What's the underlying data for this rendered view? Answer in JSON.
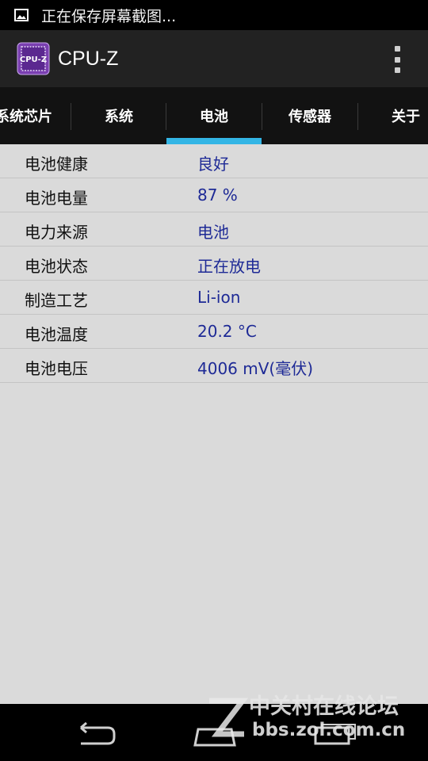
{
  "status_bar": {
    "notification_text": "正在保存屏幕截图...",
    "icon": "image-icon"
  },
  "action_bar": {
    "app_icon_text": "CPU-Z",
    "title": "CPU-Z"
  },
  "tabs": [
    {
      "label": "系统芯片",
      "active": false
    },
    {
      "label": "系统",
      "active": false
    },
    {
      "label": "电池",
      "active": true
    },
    {
      "label": "传感器",
      "active": false
    },
    {
      "label": "关于",
      "active": false
    }
  ],
  "battery_rows": [
    {
      "key": "电池健康",
      "value": "良好"
    },
    {
      "key": "电池电量",
      "value": "87 %"
    },
    {
      "key": "电力来源",
      "value": "电池"
    },
    {
      "key": "电池状态",
      "value": "正在放电"
    },
    {
      "key": "制造工艺",
      "value": "Li-ion"
    },
    {
      "key": "电池温度",
      "value": "20.2 °C"
    },
    {
      "key": "电池电压",
      "value": "4006 mV(毫伏)"
    }
  ],
  "watermark": {
    "name": "中关村在线论坛",
    "url": "bbs.zol.com.cn"
  },
  "colors": {
    "accent": "#33b5e5",
    "value_text": "#1e2a96",
    "background": "#dadada"
  }
}
